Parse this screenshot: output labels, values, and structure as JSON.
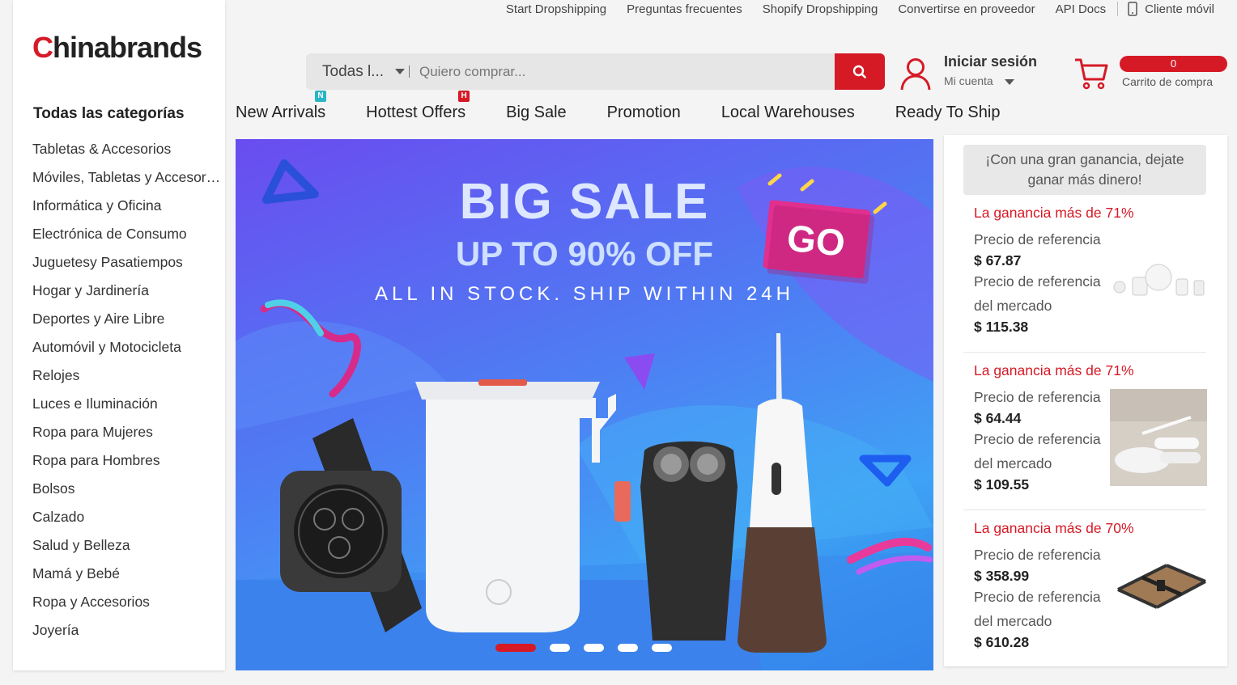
{
  "top_links": [
    "Start Dropshipping",
    "Preguntas frecuentes",
    "Shopify Dropshipping",
    "Convertirse en proveedor",
    "API Docs"
  ],
  "mobile_client_label": "Cliente móvil",
  "logo": {
    "first_letter": "C",
    "rest": "hinabrands",
    "accent_color": "#d61a26"
  },
  "sidebar": {
    "title": "Todas las categorías",
    "categories": [
      "Tabletas & Accesorios",
      "Móviles, Tabletas y Accesorios",
      "Informática y Oficina",
      "Electrónica de Consumo",
      "Juguetesy Pasatiempos",
      "Hogar y Jardinería",
      "Deportes y Aire Libre",
      "Automóvil y Motocicleta",
      "Relojes",
      "Luces e Iluminación",
      "Ropa para Mujeres",
      "Ropa para Hombres",
      "Bolsos",
      "Calzado",
      "Salud y Belleza",
      "Mamá y Bebé",
      "Ropa y Accesorios",
      "Joyería"
    ]
  },
  "search": {
    "category": "Todas l...",
    "placeholder": "Quiero comprar..."
  },
  "account": {
    "title": "Iniciar sesión",
    "subtitle": "Mi cuenta"
  },
  "cart": {
    "count": "0",
    "label": "Carrito de compra"
  },
  "nav": [
    {
      "label": "New Arrivals",
      "tag": "N",
      "tag_color": "#2bb5c4"
    },
    {
      "label": "Hottest Offers",
      "tag": "H",
      "tag_color": "#d51a26"
    },
    {
      "label": "Big Sale",
      "tag": "",
      "tag_color": ""
    },
    {
      "label": "Promotion",
      "tag": "",
      "tag_color": ""
    },
    {
      "label": "Local Warehouses",
      "tag": "",
      "tag_color": ""
    },
    {
      "label": "Ready To Ship",
      "tag": "",
      "tag_color": ""
    }
  ],
  "banner": {
    "title": "BIG SALE",
    "subtitle": "UP TO 90% OFF",
    "tagline": "ALL IN STOCK. SHIP WITHIN 24H",
    "go_label": "GO",
    "slides": 5,
    "active_slide": 1
  },
  "right_panel": {
    "promo_line1": "¡Con una gran ganancia, dejate",
    "promo_line2": "ganar más dinero!",
    "products": [
      {
        "gain": "La ganancia más de 71%",
        "ref_label": "Precio de referencia",
        "ref_price": "$ 67.87",
        "market_label1": "Precio de referencia",
        "market_label2": "del mercado",
        "market_price": "$ 115.38"
      },
      {
        "gain": "La ganancia más de 71%",
        "ref_label": "Precio de referencia",
        "ref_price": "$ 64.44",
        "market_label1": "Precio de referencia",
        "market_label2": "del mercado",
        "market_price": "$ 109.55"
      },
      {
        "gain": "La ganancia más de 70%",
        "ref_label": "Precio de referencia",
        "ref_price": "$ 358.99",
        "market_label1": "Precio de referencia",
        "market_label2": "del mercado",
        "market_price": "$ 610.28"
      }
    ]
  }
}
